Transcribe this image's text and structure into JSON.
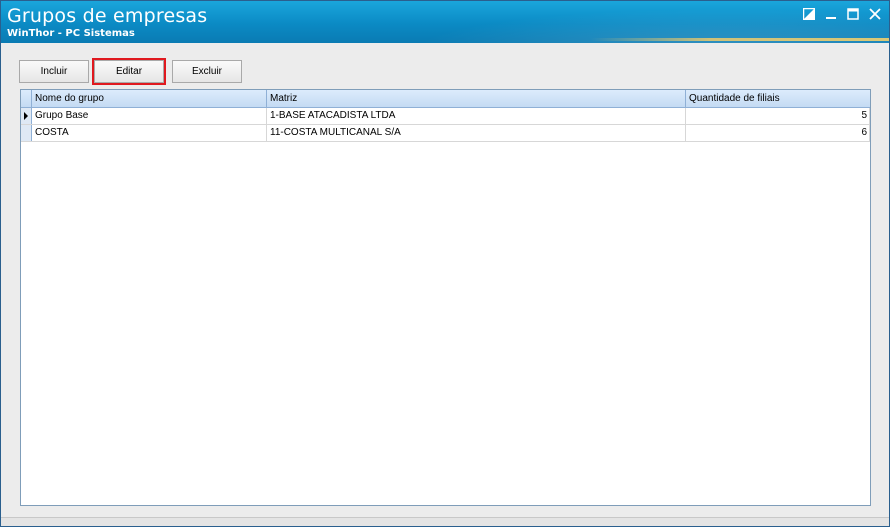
{
  "window": {
    "title": "Grupos de empresas",
    "subtitle": "WinThor - PC Sistemas",
    "controls": [
      "restore-icon",
      "minimize-icon",
      "maximize-icon",
      "close-icon"
    ],
    "colors": {
      "titlebar": "#0b8ac4",
      "highlight": "#e0191f",
      "grid_header": "#c4dbf3"
    }
  },
  "toolbar": {
    "incluir_label": "Incluir",
    "editar_label": "Editar",
    "excluir_label": "Excluir"
  },
  "grid": {
    "columns": [
      "Nome do grupo",
      "Matriz",
      "Quantidade de filiais"
    ],
    "rows": [
      {
        "nome": "Grupo Base",
        "matriz": "1-BASE ATACADISTA LTDA",
        "qtd": "5",
        "selected": true
      },
      {
        "nome": "COSTA",
        "matriz": "11-COSTA MULTICANAL S/A",
        "qtd": "6",
        "selected": false
      }
    ]
  }
}
